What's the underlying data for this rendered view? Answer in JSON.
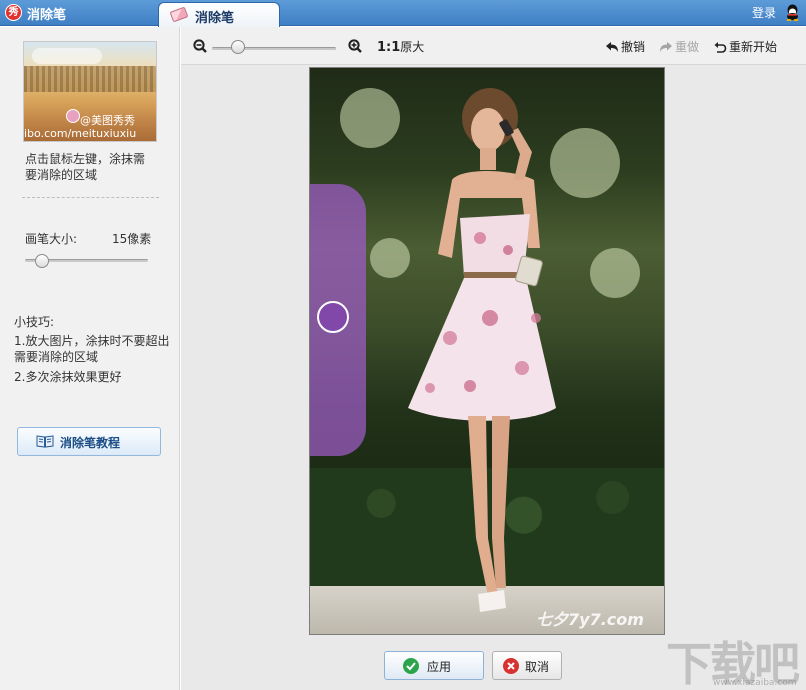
{
  "titlebar": {
    "app_logo_glyph": "秀",
    "app_title": "消除笔",
    "active_tab": "消除笔",
    "login": "登录"
  },
  "left_panel": {
    "thumbnail": {
      "watermark": "@美图秀秀",
      "url": "ibo.com/meituxiuxiu"
    },
    "instruction": "点击鼠标左键，涂抹需要消除的区域",
    "brush_size_label": "画笔大小:",
    "brush_size_value": "15像素",
    "brush_size_level": 0.1,
    "tips_title": "小技巧:",
    "tips": [
      "1.放大图片，涂抹时不要超出需要消除的区域",
      "2.多次涂抹效果更好"
    ],
    "tutorial_button": "消除笔教程"
  },
  "toolbar": {
    "zoom_level": 0.2,
    "actual_size_ratio": "1:1",
    "actual_size_label": "原大",
    "undo": "撤销",
    "redo": "重做",
    "reset": "重新开始"
  },
  "canvas": {
    "watermark": "七夕7y7.com"
  },
  "actions": {
    "apply": "应用",
    "cancel": "取消"
  },
  "site_watermark": {
    "text": "下载吧",
    "url": "www.xiazaiba.com"
  },
  "colors": {
    "titlebar": "#4a8bd0",
    "brush_highlight": "#a05cc8",
    "apply_icon": "#2ca44b",
    "cancel_icon": "#d7322f"
  },
  "icons": [
    "app-logo-icon",
    "eraser-icon",
    "qq-icon",
    "weibo-icon",
    "zoom-out-icon",
    "zoom-in-icon",
    "undo-icon",
    "redo-icon",
    "reset-icon",
    "book-icon",
    "check-icon",
    "close-icon"
  ]
}
